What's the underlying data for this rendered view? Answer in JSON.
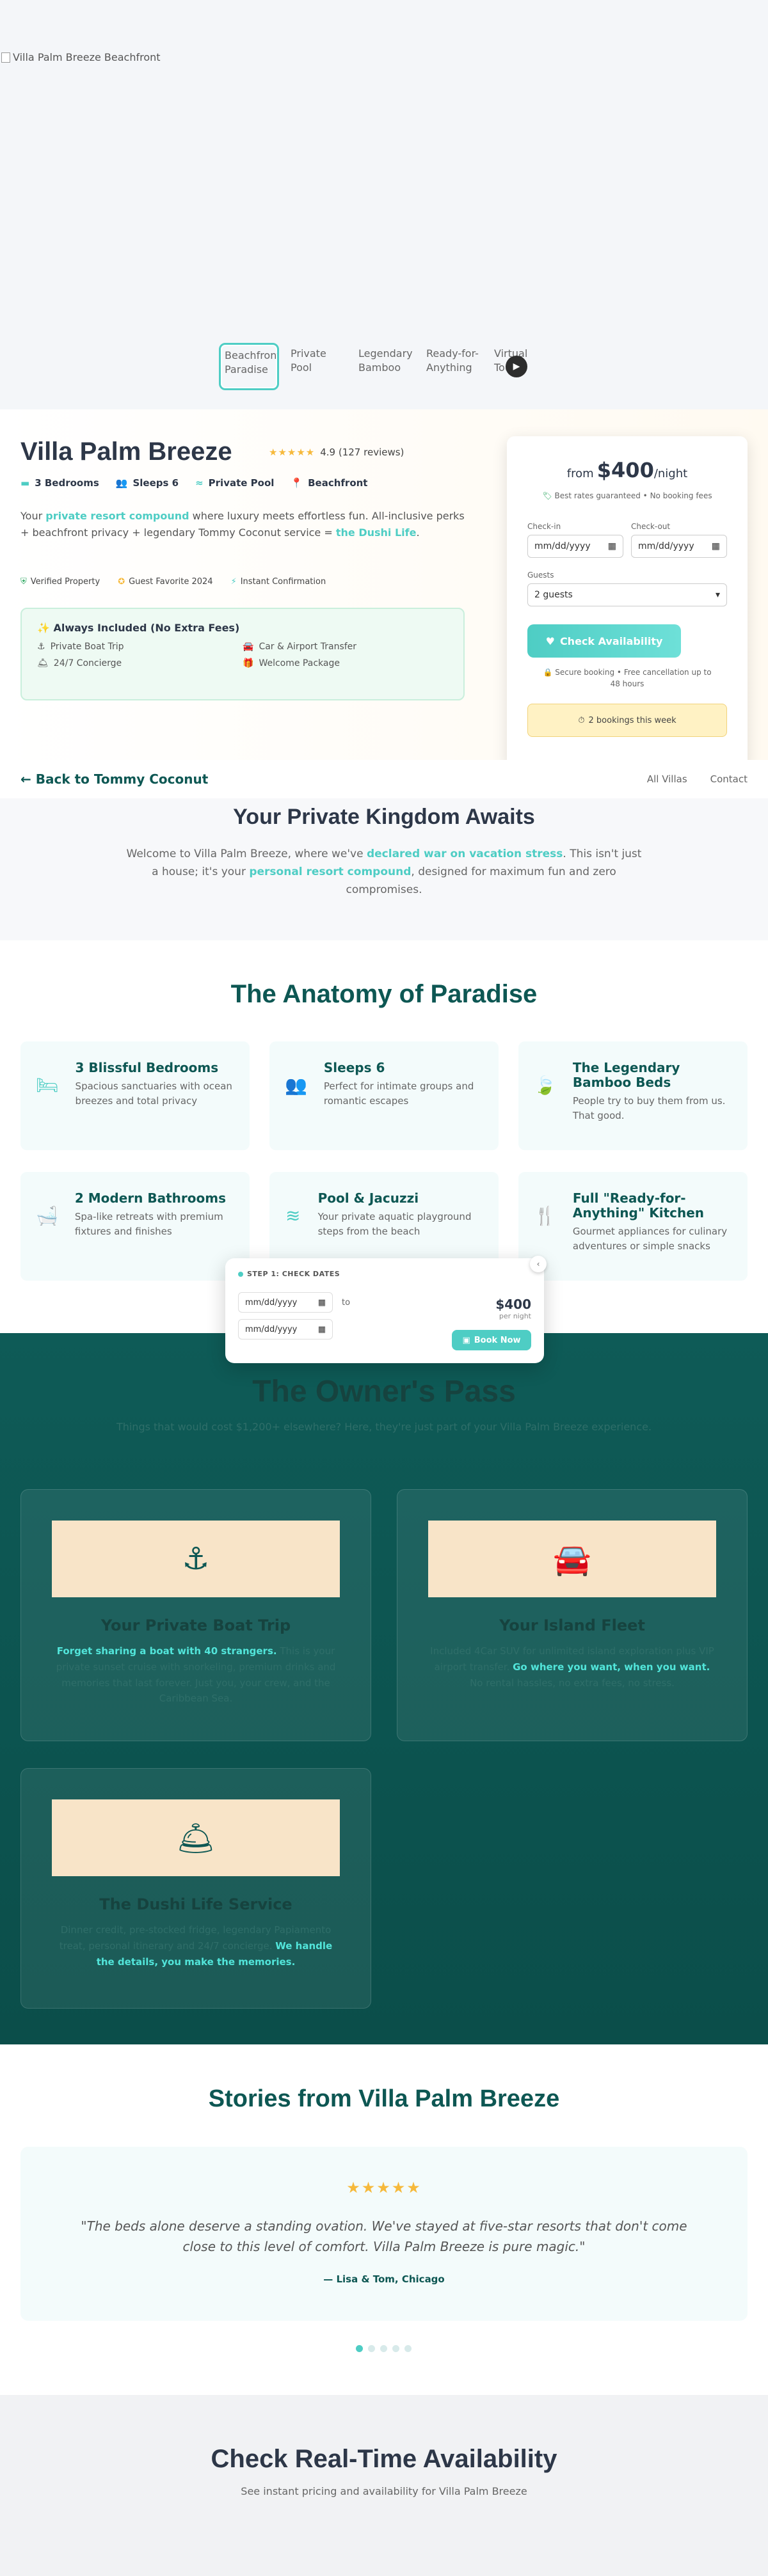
{
  "hero": {
    "alt": "Villa Palm Breeze Beachfront",
    "thumbs": [
      "Beachfront Paradise",
      "Private Pool",
      "Legendary Bamboo",
      "Ready-for-Anything",
      "Virtual Tour"
    ],
    "play_icon": "play-icon"
  },
  "overview": {
    "title": "Villa Palm Breeze",
    "stars": "★★★★★",
    "rating": "4.9 (127 reviews)",
    "facts": [
      "3 Bedrooms",
      "Sleeps 6",
      "Private Pool",
      "Beachfront"
    ],
    "desc_1": "Your ",
    "desc_hl_1": "private resort compound",
    "desc_2": " where luxury meets effortless fun. All-inclusive perks + beachfront privacy + legendary Tommy Coconut service = ",
    "desc_hl_2": "the Dushi Life",
    "desc_3": ".",
    "badges": [
      "Verified Property",
      "Guest Favorite 2024",
      "Instant Confirmation"
    ],
    "included_title": "Always Included (No Extra Fees)",
    "included": [
      "Private Boat Trip",
      "Car & Airport Transfer",
      "24/7 Concierge",
      "Welcome Package"
    ]
  },
  "booking": {
    "from": "from",
    "price": "$400",
    "per": "/night",
    "best": "Best rates guaranteed • No booking fees",
    "checkin_label": "Check-in",
    "checkout_label": "Check-out",
    "date_placeholder": "mm/dd/yyyy",
    "guests_label": "Guests",
    "guests_value": "2 guests",
    "cta": "Check Availability",
    "secure": "Secure booking • Free cancellation up to 48 hours",
    "scarcity": "2 bookings this week"
  },
  "nav": {
    "back": "← Back to Tommy Coconut",
    "links": [
      "All Villas",
      "Contact"
    ]
  },
  "kingdom": {
    "title": "Your Private Kingdom Awaits",
    "p1": "Welcome to Villa Palm Breeze, where we've ",
    "hl1": "declared war on vacation stress",
    "p2": ". This isn't just a house; it's your ",
    "hl2": "personal resort compound",
    "p3": ", designed for maximum fun and zero compromises."
  },
  "anatomy": {
    "title": "The Anatomy of Paradise",
    "cards": [
      {
        "icon": "bed-icon",
        "title": "3 Blissful Bedrooms",
        "text": "Spacious sanctuaries with ocean breezes and total privacy"
      },
      {
        "icon": "users-icon",
        "title": "Sleeps 6",
        "text": "Perfect for intimate groups and romantic escapes"
      },
      {
        "icon": "leaf-icon",
        "title": "The Legendary Bamboo Beds",
        "text": "People try to buy them from us. That good."
      },
      {
        "icon": "bath-icon",
        "title": "2 Modern Bathrooms",
        "text": "Spa-like retreats with premium fixtures and finishes"
      },
      {
        "icon": "pool-icon",
        "title": "Pool & Jacuzzi",
        "text": "Your private aquatic playground steps from the beach"
      },
      {
        "icon": "utensils-icon",
        "title": "Full \"Ready-for-Anything\" Kitchen",
        "text": "Gourmet appliances for culinary adventures or simple snacks"
      }
    ]
  },
  "widget": {
    "step": "STEP 1: CHECK DATES",
    "placeholder": "mm/dd/yyyy",
    "to": "to",
    "price": "$400",
    "per": "per night",
    "book": "Book Now"
  },
  "owners": {
    "title": "The Owner's Pass",
    "sub": "Things that would cost $1,200+ elsewhere? Here, they're just part of your Villa Palm Breeze experience.",
    "passes": [
      {
        "icon": "anchor-icon",
        "title": "Your Private Boat Trip",
        "hl": "Forget sharing a boat with 40 strangers.",
        "text": " This is your private sunset cruise with snorkeling, premium drinks and memories that last forever. Just you, your crew, and the Caribbean Sea."
      },
      {
        "icon": "car-icon",
        "title": "Your Island Fleet",
        "pre": "Included 4Car SUV for unlimited island exploration plus VIP airport transfer. ",
        "hl": "Go where you want, when you want.",
        "text": " No rental hassles, no extra fees, no stress."
      },
      {
        "icon": "bell-icon",
        "title": "The Dushi Life Service",
        "pre": "Dinner credit, pre-stocked fridge, legendary Papiamento treat, personal itinerary and 24/7 concierge. ",
        "hl": "We handle the details, you make the memories.",
        "text": ""
      }
    ]
  },
  "stories": {
    "title": "Stories from Villa Palm Breeze",
    "stars": "★★★★★",
    "quote": "\"The beds alone deserve a standing ovation. We've stayed at five-star resorts that don't come close to this level of comfort. Villa Palm Breeze is pure magic.\"",
    "who": "— Lisa & Tom, Chicago"
  },
  "check": {
    "title": "Check Real-Time Availability",
    "sub": "See instant pricing and availability for Villa Palm Breeze"
  }
}
